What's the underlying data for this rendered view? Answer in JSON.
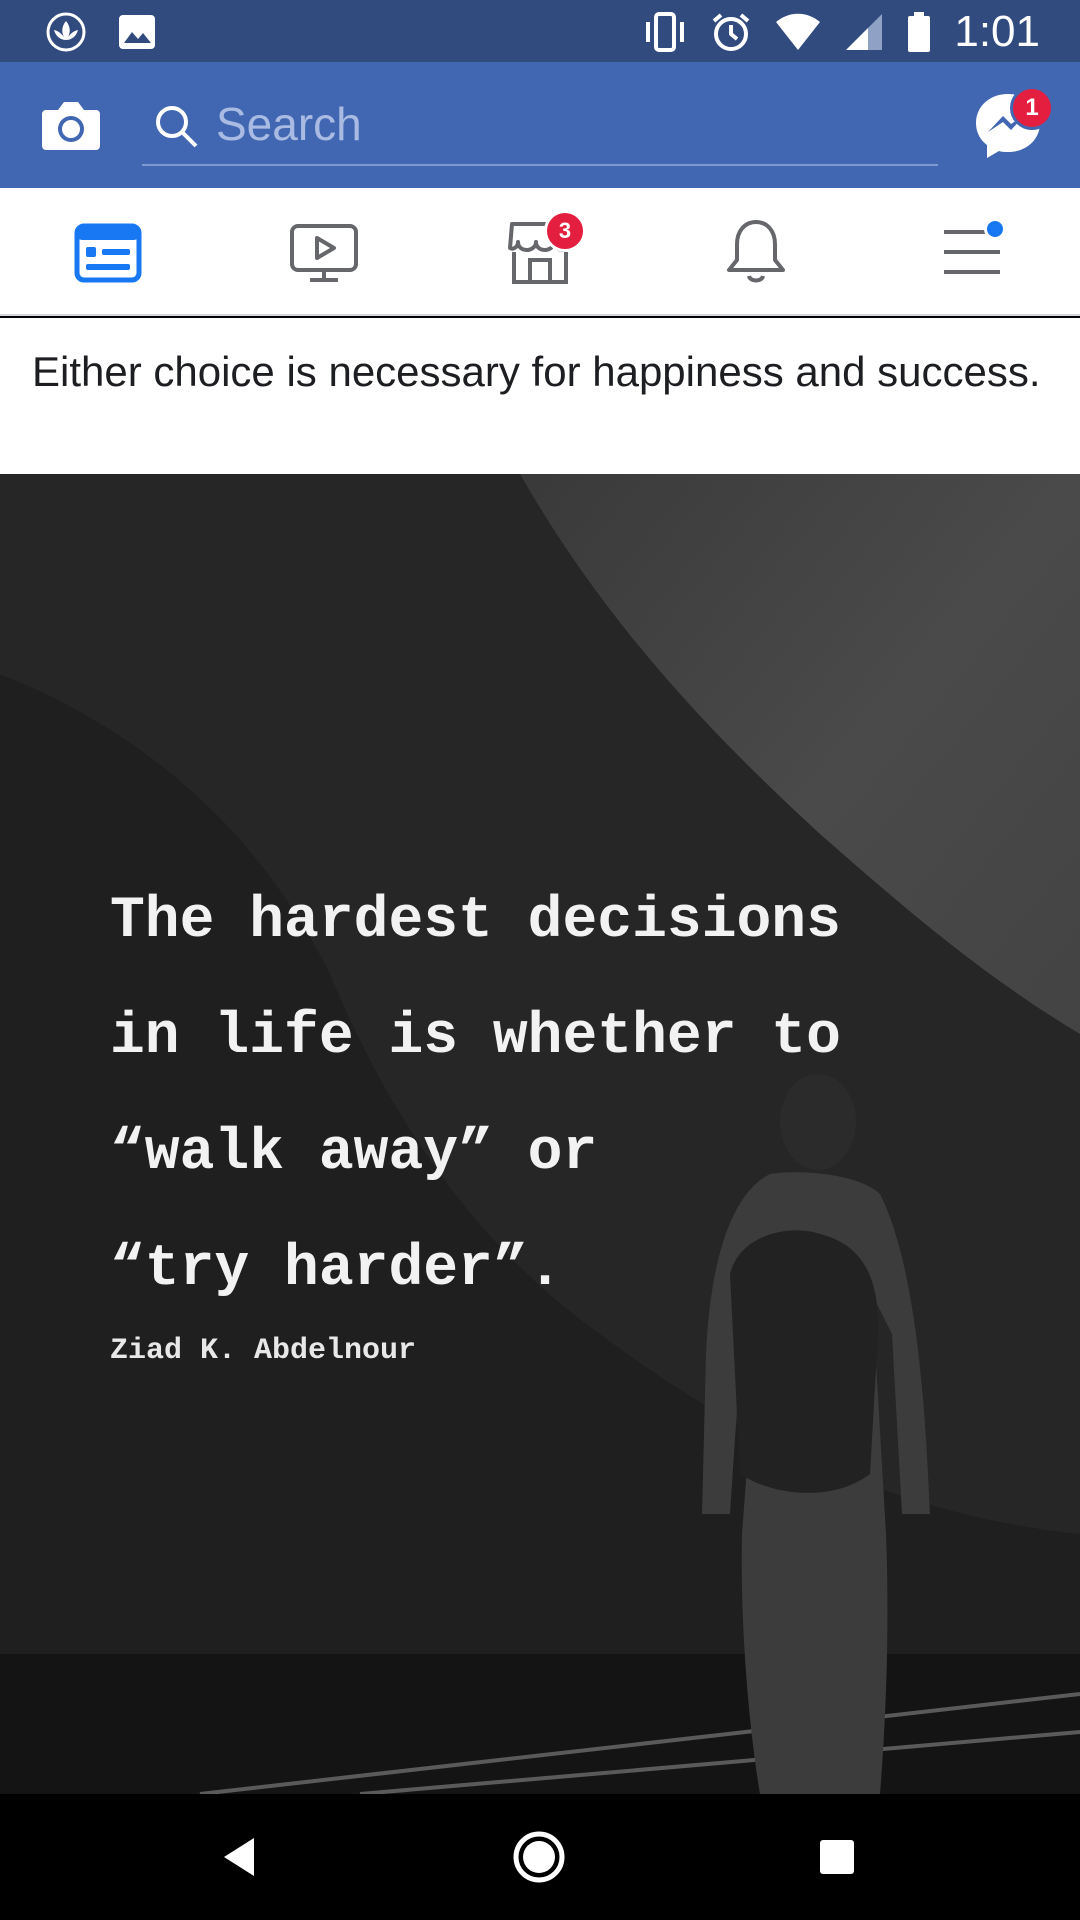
{
  "status_bar": {
    "time": "1:01",
    "left_icons": [
      "lotus-icon",
      "image-icon"
    ],
    "right_icons": [
      "vibrate-icon",
      "alarm-icon",
      "wifi-icon",
      "signal-icon",
      "battery-icon"
    ]
  },
  "header": {
    "search_placeholder": "Search",
    "messenger_badge": "1"
  },
  "tabs": [
    {
      "name": "news-feed",
      "icon": "news-feed-icon",
      "active": true
    },
    {
      "name": "watch",
      "icon": "watch-icon",
      "active": false
    },
    {
      "name": "marketplace",
      "icon": "marketplace-icon",
      "active": false,
      "badge": "3"
    },
    {
      "name": "notifications",
      "icon": "bell-icon",
      "active": false
    },
    {
      "name": "menu",
      "icon": "menu-icon",
      "active": false,
      "dot": true
    }
  ],
  "post": {
    "text": "Either choice is necessary for happiness and success.",
    "image": {
      "quote_lines": [
        "The hardest decisions",
        "in life is whether to",
        "“walk away” or",
        "“try harder”."
      ],
      "author": "Ziad K. Abdelnour"
    }
  },
  "colors": {
    "status_bar": "#314b7f",
    "header": "#4267b2",
    "accent": "#1877f2",
    "badge": "#e41e3f"
  }
}
